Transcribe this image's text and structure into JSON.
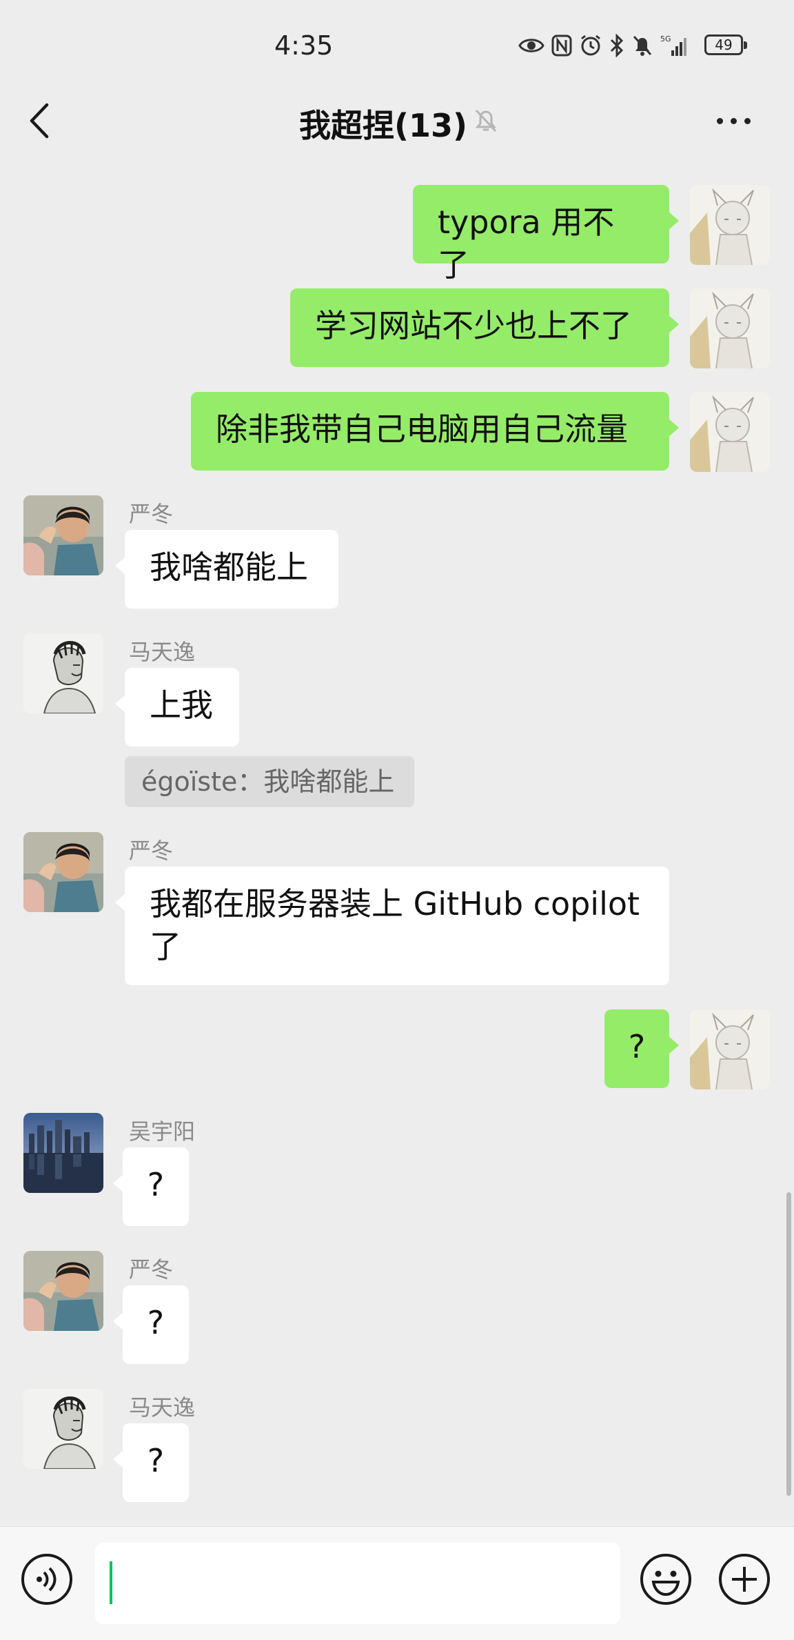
{
  "status": {
    "time": "4:35",
    "battery": "49",
    "network": "5G"
  },
  "header": {
    "title": "我超捏(13)"
  },
  "messages": [
    {
      "side": "out",
      "text": "typora 用不了"
    },
    {
      "side": "out",
      "text": "学习网站不少也上不了"
    },
    {
      "side": "out",
      "text": "除非我带自己电脑用自己流量"
    },
    {
      "side": "in",
      "sender": "严冬",
      "text": "我啥都能上"
    },
    {
      "side": "in",
      "sender": "马天逸",
      "text": "上我",
      "quote": "égoïste：我啥都能上"
    },
    {
      "side": "in",
      "sender": "严冬",
      "text": "我都在服务器装上 GitHub copilot 了"
    },
    {
      "side": "out",
      "text": "?"
    },
    {
      "side": "in",
      "sender": "吴宇阳",
      "text": "?"
    },
    {
      "side": "in",
      "sender": "严冬",
      "text": "?"
    },
    {
      "side": "in",
      "sender": "马天逸",
      "text": "?"
    }
  ],
  "input": {
    "value": ""
  }
}
